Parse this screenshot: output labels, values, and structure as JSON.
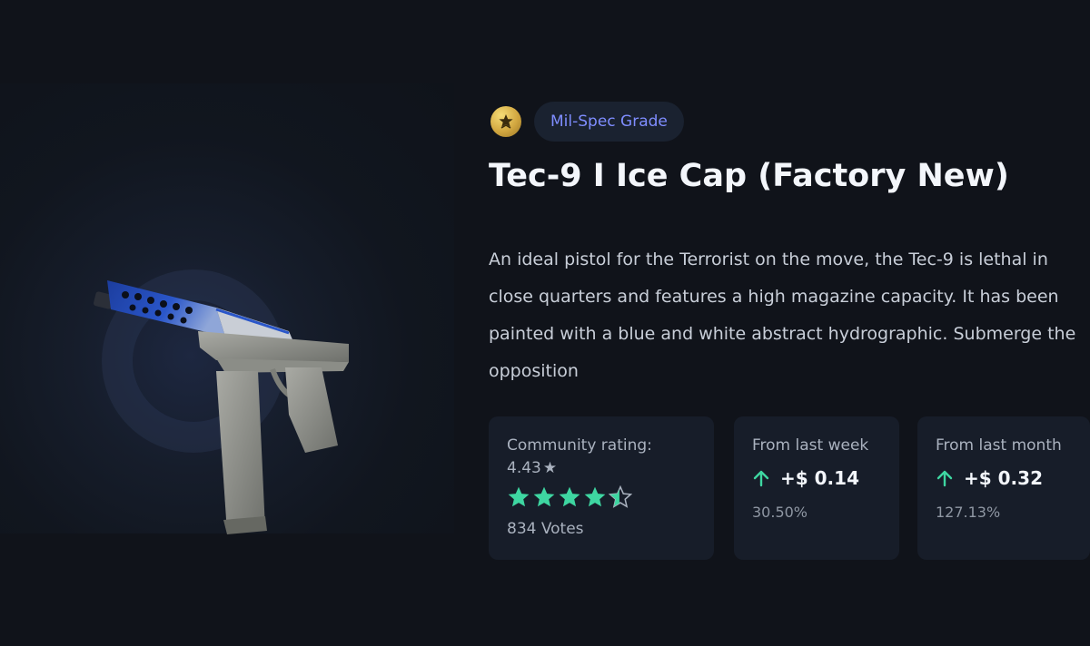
{
  "grade": {
    "icon": "military-badge-icon",
    "label": "Mil-Spec Grade",
    "color": "#7f8dff"
  },
  "item": {
    "title": "Tec-9 I Ice Cap (Factory New)",
    "description": "An ideal pistol for the Terrorist on the move, the Tec-9 is lethal in close quarters and features a high magazine capacity. It has been painted with a blue and white abstract hydrographic. Submerge the opposition",
    "image": "tec-9-ice-cap-image"
  },
  "rating": {
    "label": "Community rating:",
    "value": "4.43",
    "stars_value": 4.43,
    "stars_max": 5,
    "votes": "834 Votes",
    "star_color": "#3ed6a1"
  },
  "week": {
    "label": "From last week",
    "change": "+$ 0.14",
    "percent": "30.50%"
  },
  "month": {
    "label": "From last month",
    "change": "+$ 0.32",
    "percent": "127.13%"
  },
  "colors": {
    "background": "#10131a",
    "card": "#171d29",
    "accent_green": "#3ed6a1"
  }
}
